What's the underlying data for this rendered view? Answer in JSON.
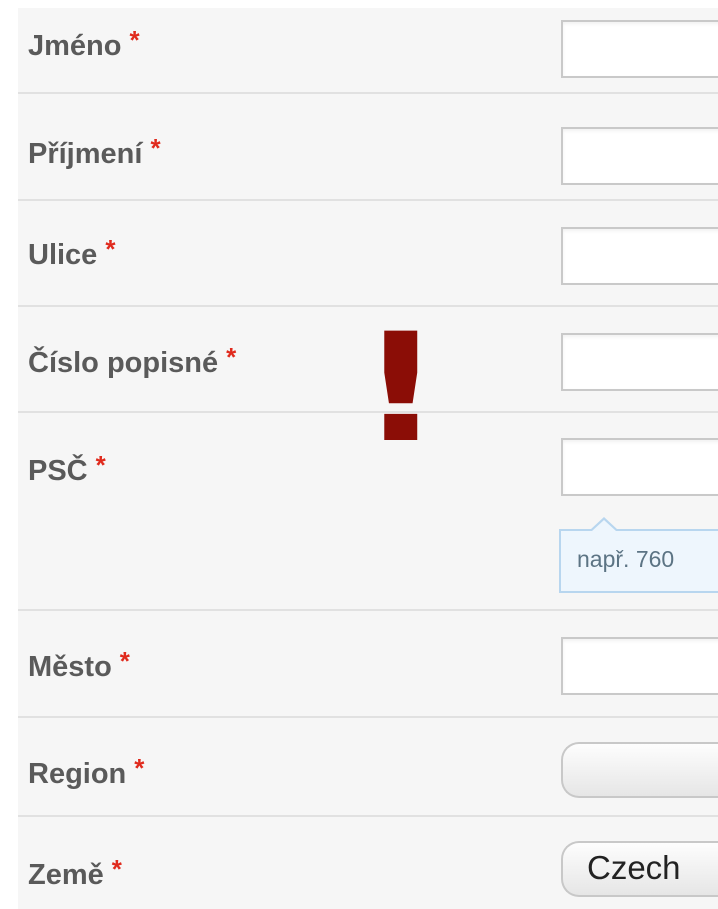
{
  "fields": [
    {
      "label": "Jméno",
      "required": "*",
      "value": ""
    },
    {
      "label": "Příjmení",
      "required": "*",
      "value": ""
    },
    {
      "label": "Ulice",
      "required": "*",
      "value": ""
    },
    {
      "label": "Číslo popisné",
      "required": "*",
      "value": ""
    },
    {
      "label": "PSČ",
      "required": "*",
      "value": "",
      "hint": "např. 760"
    },
    {
      "label": "Město",
      "required": "*",
      "value": ""
    },
    {
      "label": "Region",
      "required": "*",
      "selected": ""
    },
    {
      "label": "Země",
      "required": "*",
      "selected": "Czech"
    }
  ],
  "warning": {
    "symbol": "!",
    "color": "#8b0d06"
  },
  "colors": {
    "required": "#e02a1d",
    "hint_border": "#b8d6ef",
    "hint_bg": "#eef6fd"
  }
}
